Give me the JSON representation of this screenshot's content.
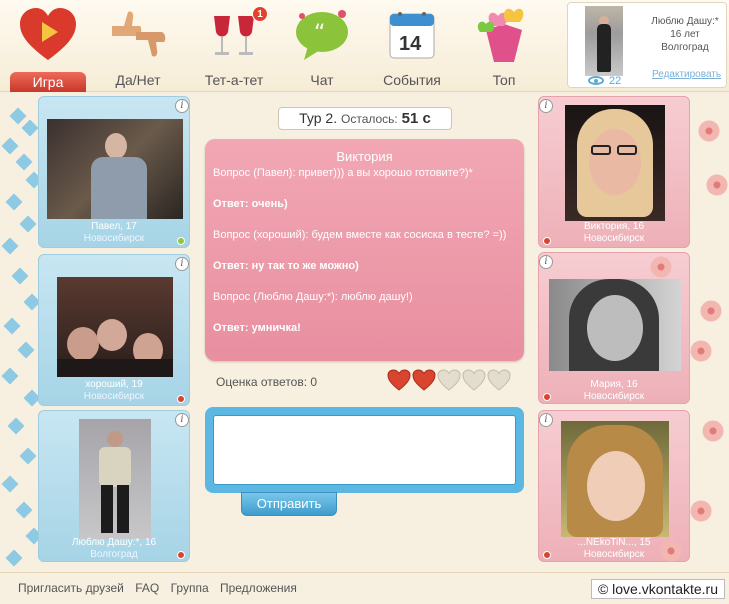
{
  "nav": {
    "items": [
      {
        "label": "Игра",
        "icon": "heart-play-icon"
      },
      {
        "label": "Да/Нет",
        "icon": "thumbs-icon"
      },
      {
        "label": "Тет-а-тет",
        "icon": "wine-glasses-icon",
        "badge": "1"
      },
      {
        "label": "Чат",
        "icon": "chat-bubble-icon"
      },
      {
        "label": "События",
        "icon": "calendar-icon",
        "calendar_day": "14"
      },
      {
        "label": "Топ",
        "icon": "gift-hearts-icon"
      }
    ],
    "active": "Игра"
  },
  "profile": {
    "name": "Люблю Дашу:*",
    "age": "16 лет",
    "city": "Волгоград",
    "views": "22",
    "edit_label": "Редактировать"
  },
  "left_cards": [
    {
      "name": "Павел, 17",
      "city": "Новосибирск",
      "status": "online"
    },
    {
      "name": "хороший, 19",
      "city": "Новосибирск",
      "status": "offline"
    },
    {
      "name": "Люблю Дашу:*, 16",
      "city": "Волгоград",
      "status": "offline"
    }
  ],
  "right_cards": [
    {
      "name": "Виктория, 16",
      "city": "Новосибирск",
      "status": "offline"
    },
    {
      "name": "Мария, 16",
      "city": "Новосибирск",
      "status": "offline"
    },
    {
      "name": "...NEkoTiN..., 15",
      "city": "Новосибирск",
      "status": "offline"
    }
  ],
  "tour": {
    "label": "Тур",
    "number": "2.",
    "remaining_label": "Осталось:",
    "seconds": "51 с"
  },
  "qa": {
    "title": "Виктория",
    "lines": [
      {
        "text": "Вопрос (Павел): привет))) а вы хорошо готовите?)*",
        "bold": false
      },
      {
        "text": "Ответ: очень)",
        "bold": true
      },
      {
        "text": "Вопрос (хороший): будем вместе как сосиска в тесте? =))",
        "bold": false
      },
      {
        "text": "Ответ: ну так то же можно)",
        "bold": true
      },
      {
        "text": "Вопрос (Люблю Дашу:*): люблю дашу!)",
        "bold": false
      },
      {
        "text": "Ответ: умничка!",
        "bold": true
      }
    ]
  },
  "rating": {
    "label": "Оценка ответов: 0",
    "filled": 2,
    "total": 5
  },
  "chat": {
    "input_value": "",
    "send_label": "Отправить"
  },
  "footer": {
    "links": [
      "Пригласить друзей",
      "FAQ",
      "Группа",
      "Предложения"
    ],
    "copyright": "© love.vkontakte.ru"
  },
  "colors": {
    "accent_red": "#d8442e",
    "accent_blue": "#5cb8e3",
    "pink_box": "#e88fa0"
  }
}
